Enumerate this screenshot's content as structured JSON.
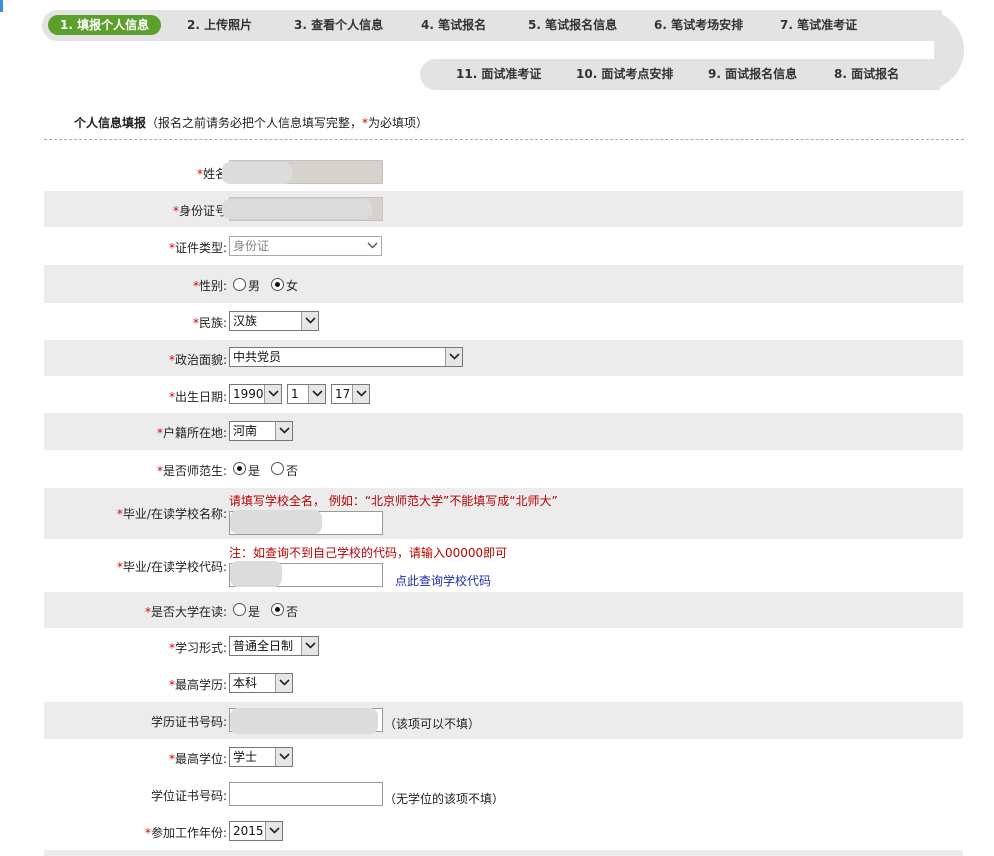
{
  "steps_top": [
    {
      "label": "1. 填报个人信息",
      "active": true
    },
    {
      "label": "2. 上传照片"
    },
    {
      "label": "3. 查看个人信息"
    },
    {
      "label": "4. 笔试报名"
    },
    {
      "label": "5. 笔试报名信息"
    },
    {
      "label": "6. 笔试考场安排"
    },
    {
      "label": "7. 笔试准考证"
    }
  ],
  "steps_bottom": [
    {
      "label": "11. 面试准考证"
    },
    {
      "label": "10. 面试考点安排"
    },
    {
      "label": "9. 面试报名信息"
    },
    {
      "label": "8. 面试报名"
    }
  ],
  "section": {
    "title": "个人信息填报",
    "note_prefix": "（报名之前请务必把个人信息填写完整，",
    "note_star": "*",
    "note_suffix": "为必填项）"
  },
  "colors": {
    "active_step": "#5ca02c",
    "required_star": "#dd0000",
    "hint": "#bb0000",
    "link": "#1a2ea8"
  },
  "form": {
    "name": {
      "label": "姓名"
    },
    "id_number": {
      "label": "身份证号"
    },
    "id_type": {
      "label": "证件类型:",
      "value": "身份证"
    },
    "gender": {
      "label": "性别:",
      "options": [
        "男",
        "女"
      ],
      "selected": "女"
    },
    "ethnicity": {
      "label": "民族:",
      "value": "汉族"
    },
    "political": {
      "label": "政治面貌:",
      "value": "中共党员"
    },
    "birth": {
      "label": "出生日期:",
      "year": "1990",
      "month": "1",
      "day": "17"
    },
    "hukou": {
      "label": "户籍所在地:",
      "value": "河南"
    },
    "normal_student": {
      "label": "是否师范生:",
      "options": [
        "是",
        "否"
      ],
      "selected": "是"
    },
    "school_name": {
      "label": "毕业/在读学校名称:",
      "hint": "请填写学校全名， 例如：“北京师范大学”不能填写成“北师大”"
    },
    "school_code": {
      "label": "毕业/在读学校代码:",
      "hint": "注：如查询不到自己学校的代码，请输入00000即可",
      "link": "点此查询学校代码"
    },
    "in_school": {
      "label": "是否大学在读:",
      "options": [
        "是",
        "否"
      ],
      "selected": "否"
    },
    "study_form": {
      "label": "学习形式:",
      "value": "普通全日制"
    },
    "education": {
      "label": "最高学历:",
      "value": "本科"
    },
    "edu_cert": {
      "label": "学历证书号码:",
      "note": "（该项可以不填）"
    },
    "degree": {
      "label": "最高学位:",
      "value": "学士"
    },
    "degree_cert": {
      "label": "学位证书号码:",
      "note": "（无学位的该项不填）"
    },
    "work_year": {
      "label": "参加工作年份:",
      "value": "2015"
    }
  }
}
